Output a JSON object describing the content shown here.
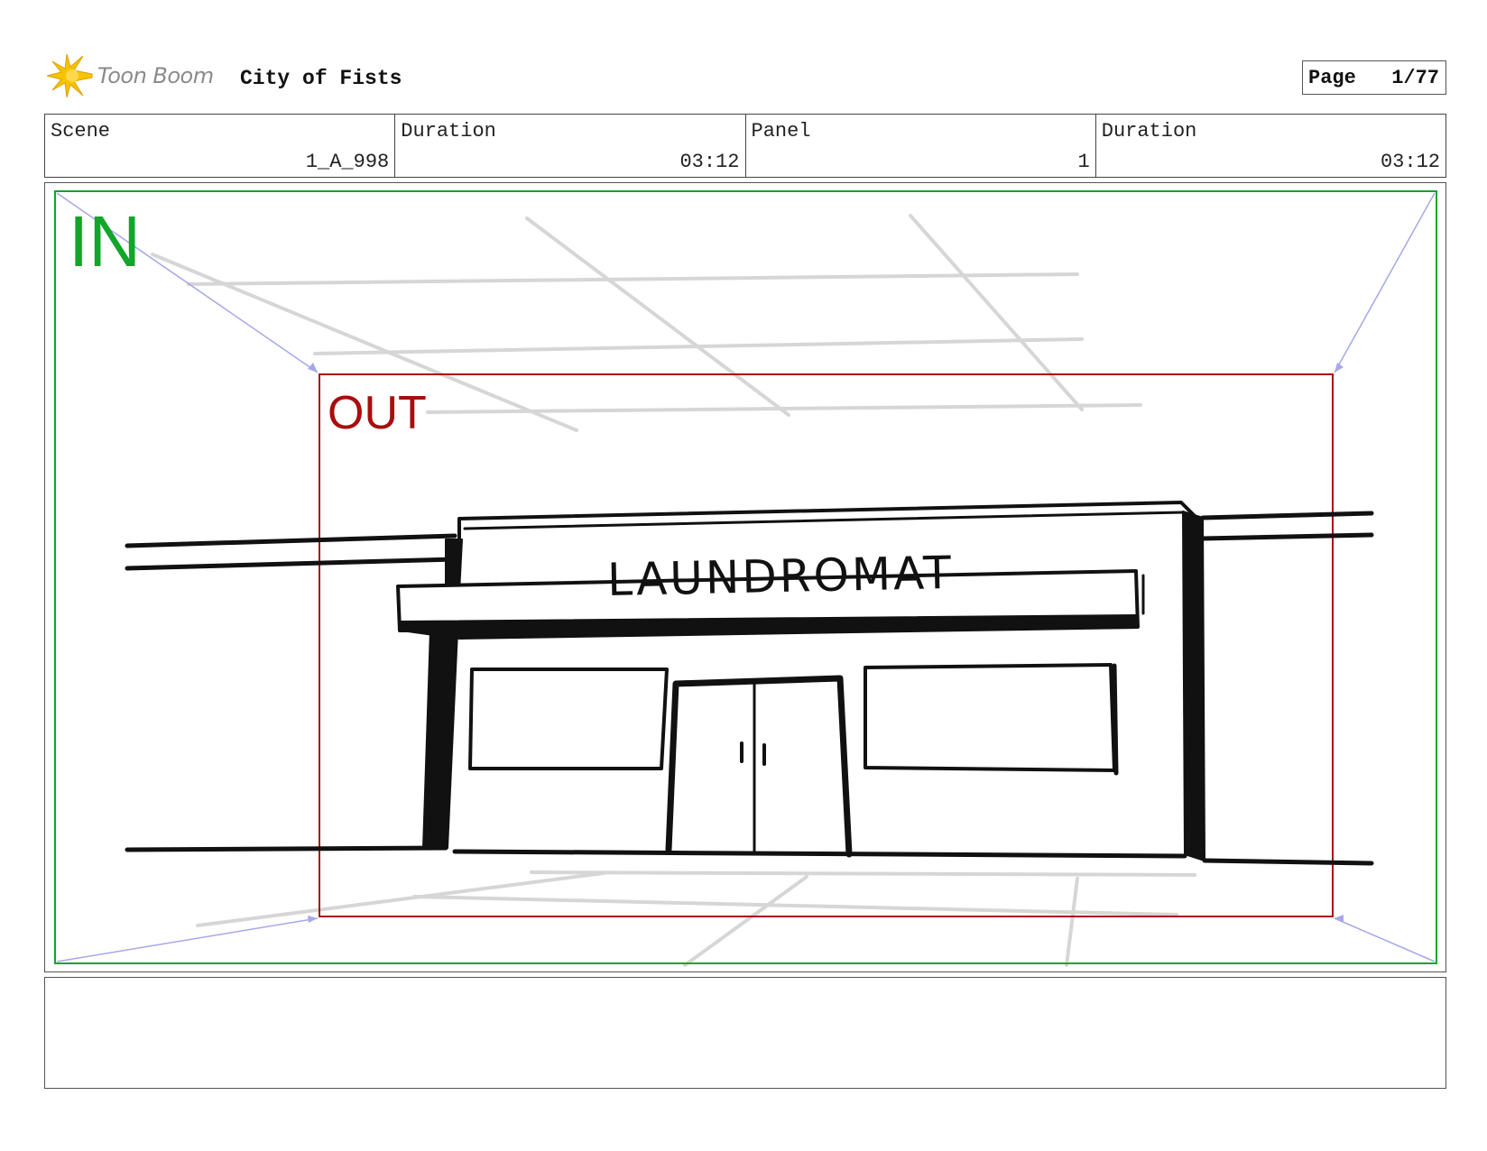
{
  "header": {
    "logo_text": "Toon Boom",
    "project_title": "City of Fists",
    "page_label": "Page",
    "page_number": "1/77"
  },
  "info": {
    "scene_label": "Scene",
    "scene_value": "1_A_998",
    "scene_duration_label": "Duration",
    "scene_duration_value": "03:12",
    "panel_label": "Panel",
    "panel_value": "1",
    "panel_duration_label": "Duration",
    "panel_duration_value": "03:12"
  },
  "panel": {
    "camera_in_label": "IN",
    "camera_out_label": "OUT",
    "sign_text": "LAUNDROMAT"
  },
  "notes": {
    "text": ""
  },
  "colors": {
    "camera_in": "#12a52a",
    "camera_out": "#a80e0e",
    "camera_arrow": "#a6a8e8",
    "sketch_guides": "#d6d6d6",
    "ink": "#111111",
    "logo_star": "#f5c400"
  }
}
